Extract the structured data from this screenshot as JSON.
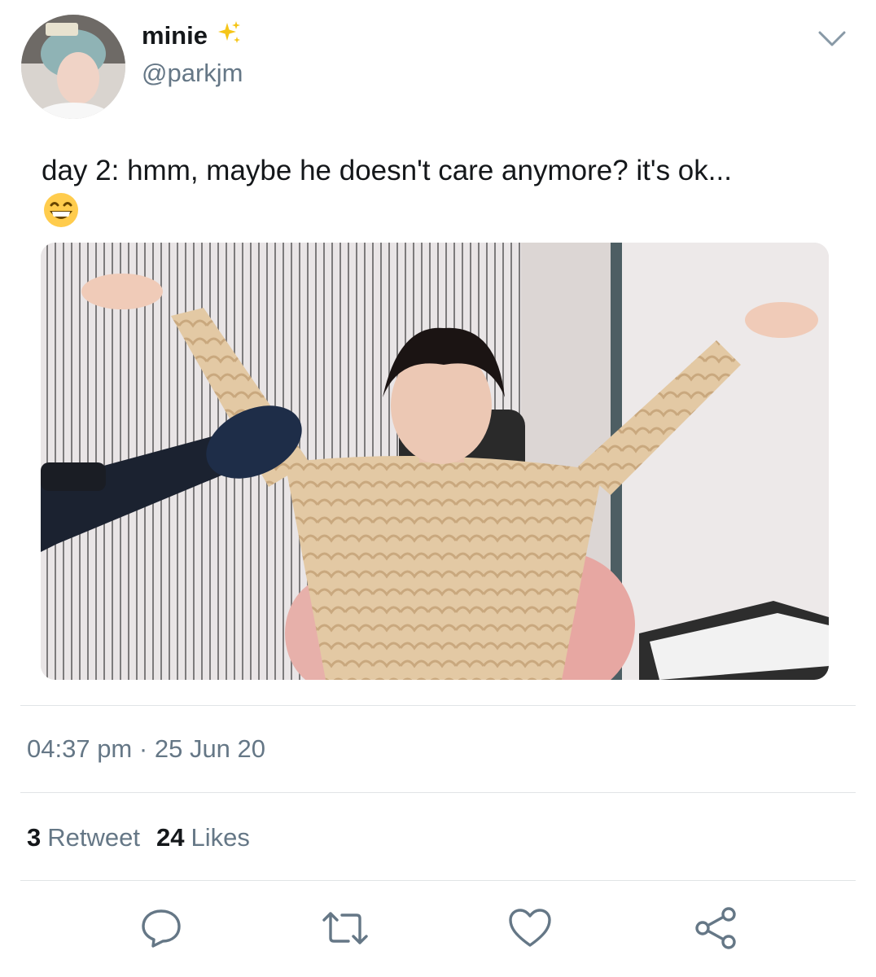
{
  "author": {
    "display_name": "minie",
    "name_icon": "sparkles-icon",
    "handle": "@parkjm",
    "avatar_icon": "profile-photo"
  },
  "menu_icon": "chevron-down-icon",
  "tweet": {
    "text": "day 2: hmm, maybe he doesn't care anymore? it's ok...",
    "emoji": "grinning-squinting-face-icon",
    "media": "photo: person in knit sweater with arms raised next to microphone and keyboard"
  },
  "timestamp": {
    "time": "04:37 pm",
    "separator": "·",
    "date": "25 Jun 20"
  },
  "stats": {
    "retweets_count": "3",
    "retweets_label": "Retweet",
    "likes_count": "24",
    "likes_label": "Likes"
  },
  "actions": [
    {
      "icon": "reply-icon"
    },
    {
      "icon": "retweet-icon"
    },
    {
      "icon": "like-icon"
    },
    {
      "icon": "share-icon"
    }
  ],
  "colors": {
    "text": "#14171a",
    "secondary": "#657786",
    "divider": "#e1e4e6",
    "sparkle": "#f5c518"
  }
}
